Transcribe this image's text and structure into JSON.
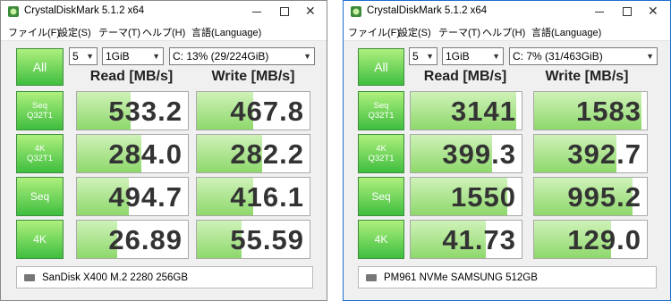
{
  "windows": [
    {
      "title": "CrystalDiskMark 5.1.2 x64",
      "menu": [
        "ファイル(F)",
        "設定(S)",
        "テーマ(T)",
        "ヘルプ(H)",
        "言語(Language)"
      ],
      "all_label": "All",
      "count": "5",
      "size": "1GiB",
      "drive_select": "C: 13% (29/224GiB)",
      "read_header": "Read [MB/s]",
      "write_header": "Write [MB/s]",
      "tests": [
        {
          "label": "Seq\nQ32T1",
          "read": "533.2",
          "write": "467.8",
          "read_fill": 0.48,
          "write_fill": 0.5
        },
        {
          "label": "4K\nQ32T1",
          "read": "284.0",
          "write": "282.2",
          "read_fill": 0.58,
          "write_fill": 0.58
        },
        {
          "label": "Seq",
          "read": "494.7",
          "write": "416.1",
          "read_fill": 0.47,
          "write_fill": 0.5
        },
        {
          "label": "4K",
          "read": "26.89",
          "write": "55.59",
          "read_fill": 0.36,
          "write_fill": 0.4
        }
      ],
      "drive_comment": "SanDisk X400 M.2 2280 256GB"
    },
    {
      "title": "CrystalDiskMark 5.1.2 x64",
      "menu": [
        "ファイル(F)",
        "設定(S)",
        "テーマ(T)",
        "ヘルプ(H)",
        "言語(Language)"
      ],
      "all_label": "All",
      "count": "5",
      "size": "1GiB",
      "drive_select": "C: 7% (31/463GiB)",
      "read_header": "Read [MB/s]",
      "write_header": "Write [MB/s]",
      "tests": [
        {
          "label": "Seq\nQ32T1",
          "read": "3141",
          "write": "1583",
          "read_fill": 0.95,
          "write_fill": 0.95
        },
        {
          "label": "4K\nQ32T1",
          "read": "399.3",
          "write": "392.7",
          "read_fill": 0.73,
          "write_fill": 0.73
        },
        {
          "label": "Seq",
          "read": "1550",
          "write": "995.2",
          "read_fill": 0.87,
          "write_fill": 0.87
        },
        {
          "label": "4K",
          "read": "41.73",
          "write": "129.0",
          "read_fill": 0.68,
          "write_fill": 0.68
        }
      ],
      "drive_comment": "PM961 NVMe SAMSUNG 512GB"
    }
  ],
  "colors": {
    "accent_green": "#3fbe3f",
    "bar_green": "#8ed86c",
    "active_border": "#1e6fd0"
  },
  "icons": [
    "crystaldiskmark-app-icon",
    "minimize-icon",
    "maximize-icon",
    "close-icon",
    "drive-icon",
    "chevron-down-icon"
  ]
}
